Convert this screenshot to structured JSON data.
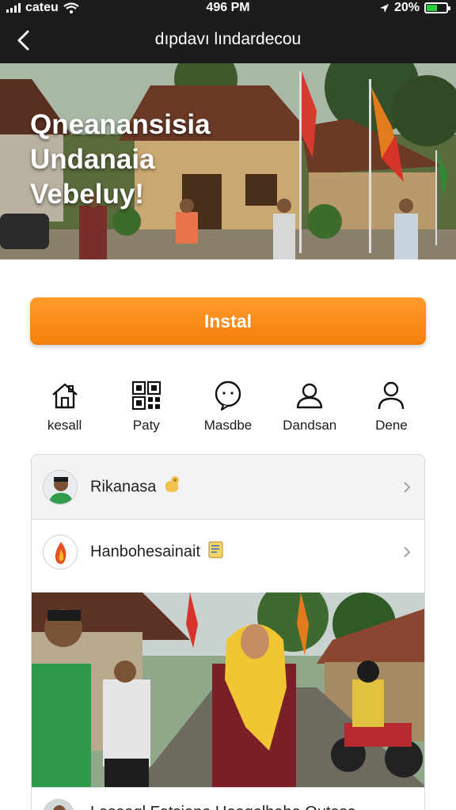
{
  "status_bar": {
    "carrier": "cateu",
    "time": "496 PM",
    "battery": "20%",
    "battery_level": 0.2
  },
  "nav": {
    "title": "dıpdavı lındardecou",
    "back_icon": "chevron-left-icon"
  },
  "hero": {
    "title_line1": "Qneanansisia",
    "title_line2": "Undanaia",
    "title_line3": "Vebeluy!"
  },
  "install_button": {
    "label": "Instal",
    "color": "#f7890f"
  },
  "quick_actions": [
    {
      "label": "kesall",
      "icon": "house-icon"
    },
    {
      "label": "Paty",
      "icon": "qr-code-icon"
    },
    {
      "label": "Masdbe",
      "icon": "chat-bubble-icon"
    },
    {
      "label": "Dandsan",
      "icon": "user-outline-icon"
    },
    {
      "label": "Dene",
      "icon": "person-icon"
    }
  ],
  "list": {
    "items": [
      {
        "label": "Rikanasa",
        "icon": "hand-emoji-icon"
      },
      {
        "label": "Hanbohesainait",
        "icon": "document-emoji-icon"
      },
      {
        "label": "Laseagl Fatsiane Ueagelhabe Outase"
      }
    ]
  }
}
